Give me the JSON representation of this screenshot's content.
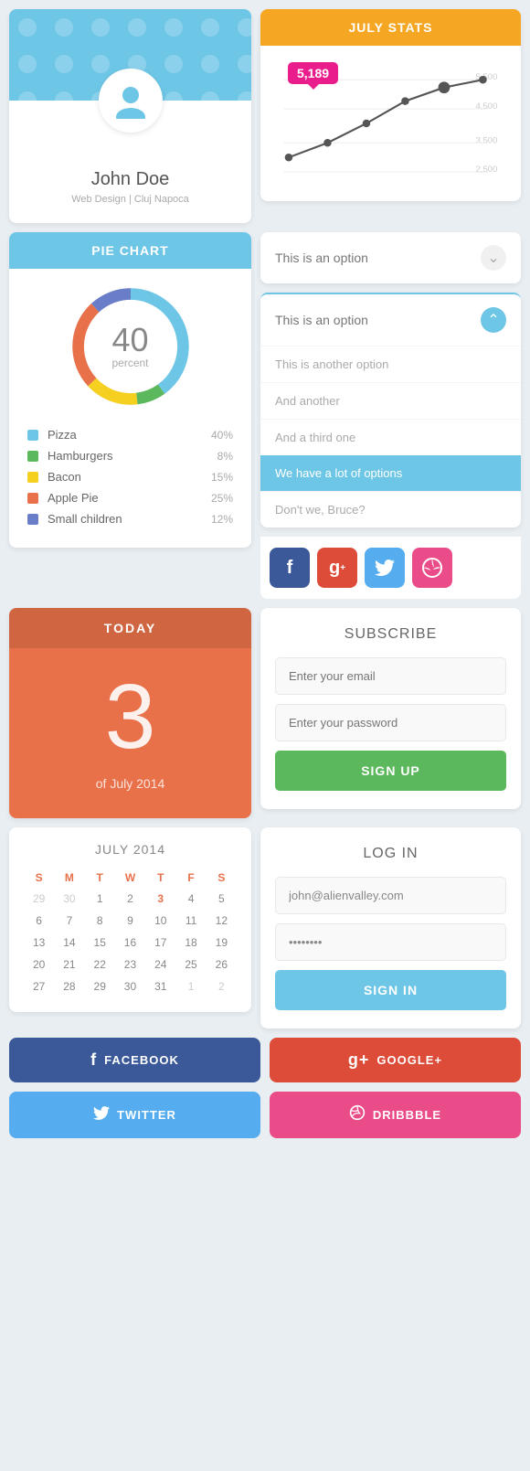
{
  "profile": {
    "name": "John Doe",
    "title": "Web Design | Cluj Napoca",
    "avatar_icon": "person-icon"
  },
  "pie_chart": {
    "header": "PIE CHART",
    "value": "40",
    "label": "percent",
    "legend": [
      {
        "label": "Pizza",
        "value": "40%",
        "color": "#6ec6e6"
      },
      {
        "label": "Hamburgers",
        "value": "8%",
        "color": "#5cb85c"
      },
      {
        "label": "Bacon",
        "value": "15%",
        "color": "#f5d020"
      },
      {
        "label": "Apple Pie",
        "value": "25%",
        "color": "#e8714a"
      },
      {
        "label": "Small children",
        "value": "12%",
        "color": "#6a7dc9"
      }
    ]
  },
  "stats": {
    "header": "JULY STATS",
    "tooltip_value": "5,189",
    "y_labels": [
      "5,500",
      "4,500",
      "3,500",
      "2,500"
    ]
  },
  "dropdown": {
    "collapsed_option": "This is an option",
    "expanded_option": "This is an option",
    "options": [
      "This is another option",
      "And another",
      "And a third one",
      "We have a lot of options",
      "Don't we, Bruce?"
    ]
  },
  "today": {
    "header": "TODAY",
    "number": "3",
    "subtitle": "of July 2014"
  },
  "subscribe": {
    "title": "SUBSCRIBE",
    "email_placeholder": "Enter your email",
    "password_placeholder": "Enter your password",
    "button": "SIGN UP"
  },
  "calendar": {
    "title": "JULY 2014",
    "days": [
      "S",
      "M",
      "T",
      "W",
      "T",
      "F",
      "S"
    ],
    "weeks": [
      [
        "29",
        "30",
        "1",
        "2",
        "3",
        "4",
        "5"
      ],
      [
        "6",
        "7",
        "8",
        "9",
        "10",
        "11",
        "12"
      ],
      [
        "13",
        "14",
        "15",
        "16",
        "17",
        "18",
        "19"
      ],
      [
        "20",
        "21",
        "22",
        "23",
        "24",
        "25",
        "26"
      ],
      [
        "27",
        "28",
        "29",
        "30",
        "31",
        "1",
        "2"
      ]
    ],
    "highlight_day": "3",
    "other_month_start": [
      "29",
      "30"
    ],
    "other_month_end": [
      "1",
      "2"
    ]
  },
  "login": {
    "title": "LOG IN",
    "email_value": "john@alienvalley.com",
    "password_dots": "●●●●●●●●",
    "button": "SIGN IN"
  },
  "social_buttons": {
    "facebook": "FACEBOOK",
    "google": "GOOGLE+",
    "twitter": "TWITTER",
    "dribbble": "DRIBBBLE"
  },
  "social_icons": {
    "facebook_color": "#3b5998",
    "google_color": "#dd4b39",
    "twitter_color": "#55acee",
    "dribbble_color": "#ea4c89"
  }
}
